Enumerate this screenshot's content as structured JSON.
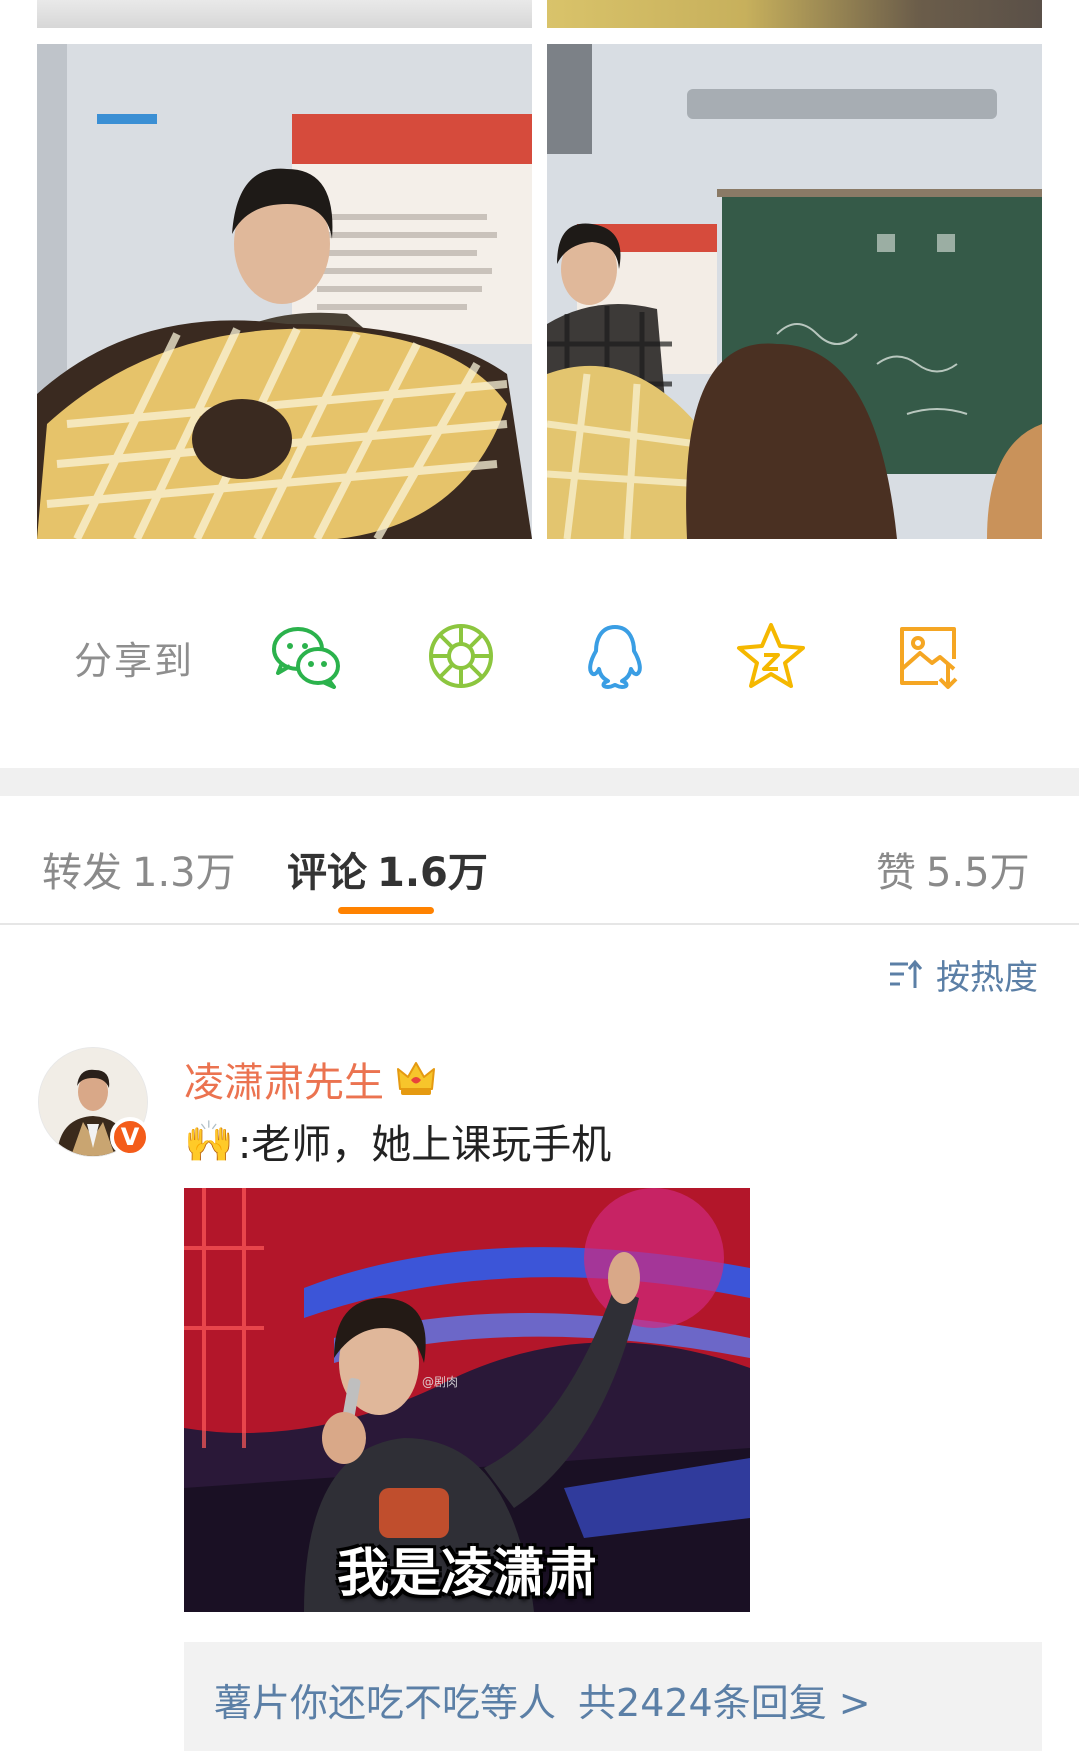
{
  "photos": [
    {
      "alt": "classroom photo 1"
    },
    {
      "alt": "classroom photo 2"
    }
  ],
  "share": {
    "label": "分享到",
    "icons": [
      "wechat-icon",
      "moments-icon",
      "qq-icon",
      "favorite-star-icon",
      "save-image-icon"
    ],
    "colors": {
      "wechat": "#2bb24c",
      "moments": "#8cc63f",
      "qq": "#3a9ee4",
      "star": "#f5b800",
      "save": "#f5a623"
    }
  },
  "tabs": {
    "repost": {
      "label": "转发",
      "count": "1.3万"
    },
    "comment": {
      "label": "评论",
      "count": "1.6万"
    },
    "like": {
      "label": "赞",
      "count": "5.5万"
    },
    "accent": "#ff8200"
  },
  "sort": {
    "label": "按热度"
  },
  "comment": {
    "username": "凌潇肃先生",
    "badge": "V",
    "text": ":老师，她上课玩手机",
    "emoji": "🙌",
    "gif_caption": "我是凌潇肃",
    "gif_watermark": "@剧肉",
    "reply_user": "薯片你还吃不吃等人",
    "reply_count": "共2424条回复 >"
  }
}
